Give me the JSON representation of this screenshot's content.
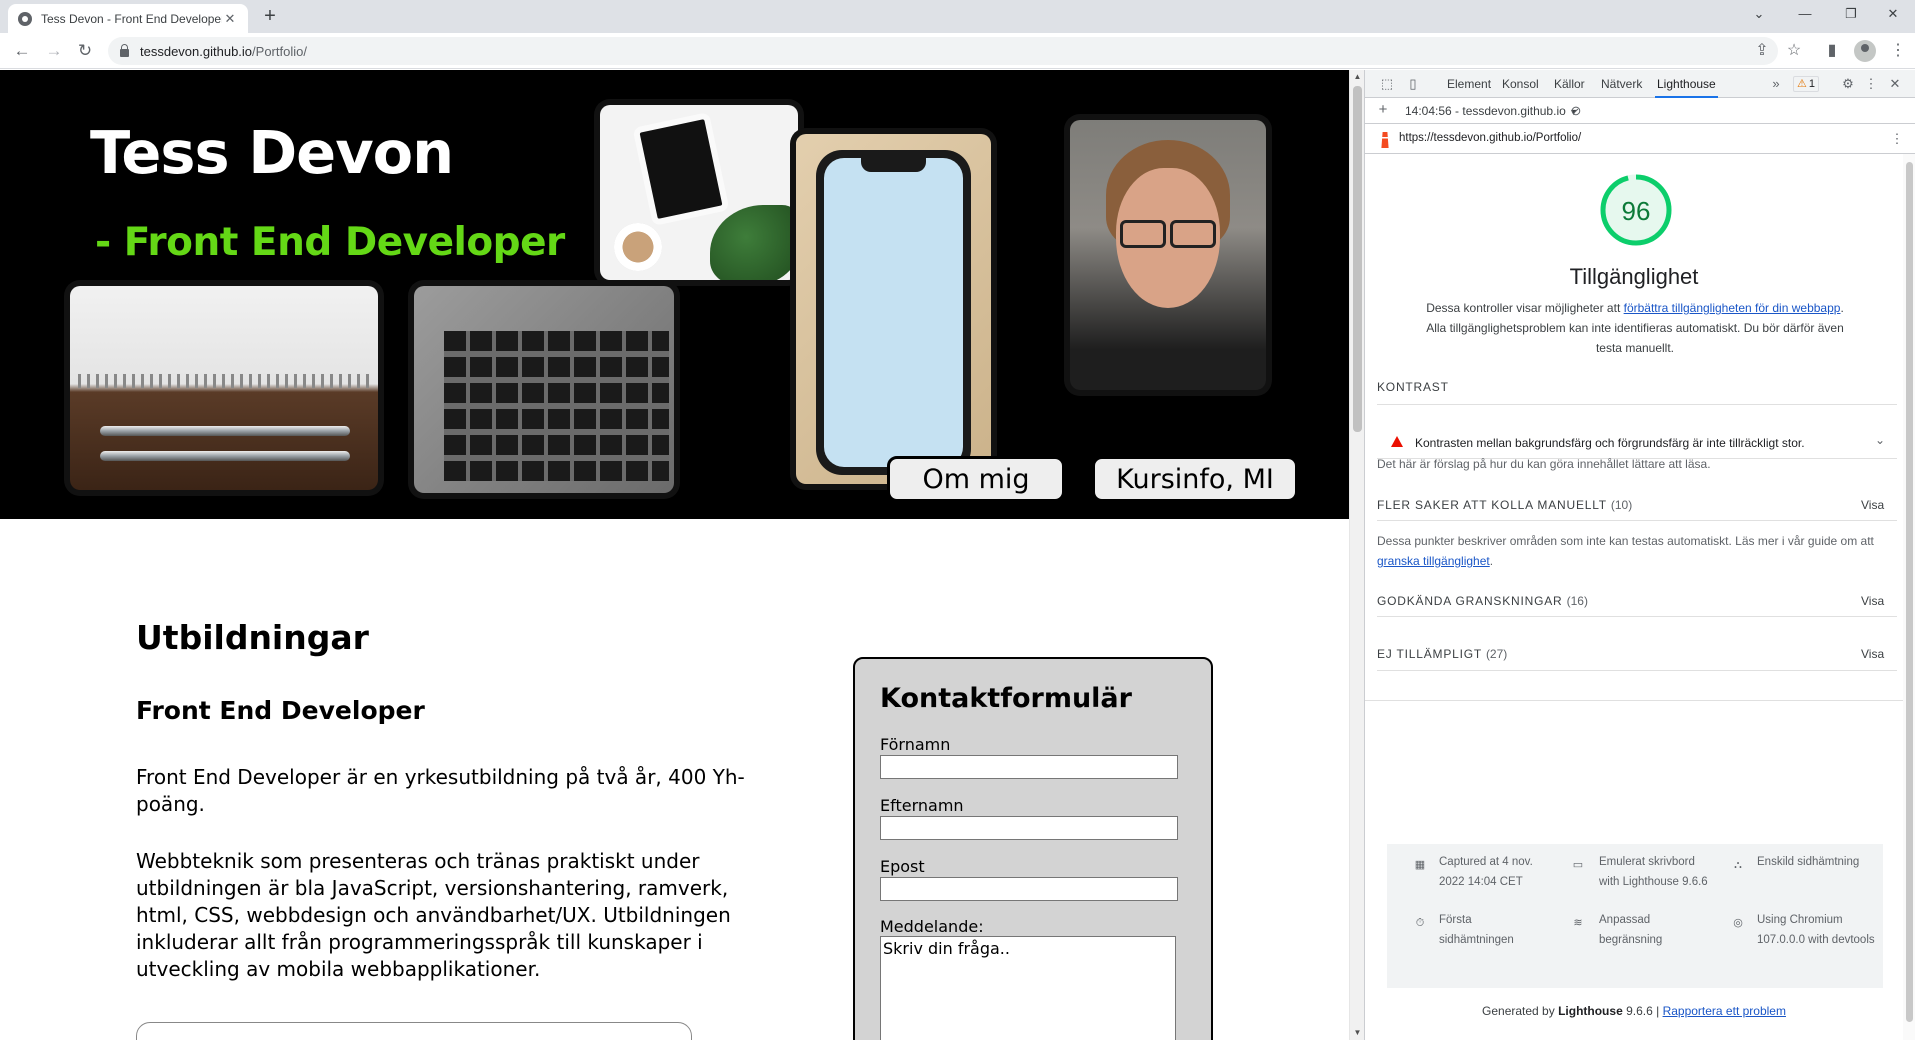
{
  "browser": {
    "tab_title": "Tess Devon - Front End Developer",
    "new_tab": "+",
    "url_host": "tessdevon.github.io",
    "url_path": "/Portfolio/",
    "icons": [
      "back-icon",
      "forward-icon",
      "reload-icon",
      "share-icon",
      "star-icon",
      "side-panel-icon",
      "profile-icon",
      "menu-icon"
    ]
  },
  "hero": {
    "name": "Tess Devon",
    "role": "- Front End Developer",
    "buttons": [
      "Om mig",
      "Kursinfo, MI"
    ]
  },
  "main": {
    "heading": "Utbildningar",
    "subheading": "Front End Developer",
    "paragraph1": "Front End Developer är en yrkesutbildning på två år, 400 Yh-poäng.",
    "paragraph2": "Webbteknik som presenteras och tränas praktiskt under utbildningen är bla JavaScript, versionshantering, ramverk, html, CSS, webbdesign och användbarhet/UX. Utbildningen inkluderar allt från programmeringsspråk till kunskaper i utveckling av mobila webbapplikationer."
  },
  "form": {
    "title": "Kontaktformulär",
    "firstname_label": "Förnamn",
    "lastname_label": "Efternamn",
    "email_label": "Epost",
    "message_label": "Meddelande:",
    "message_placeholder": "Skriv din fråga.."
  },
  "devtools": {
    "tabs": [
      "Element",
      "Konsol",
      "Källor",
      "Nätverk",
      "Lighthouse"
    ],
    "more": "»",
    "warning_count": "1",
    "report_select": "14:04:56 - tessdevon.github.io",
    "report_url": "https://tessdevon.github.io/Portfolio/",
    "score": "96",
    "score_fraction": 0.96,
    "score_color": "#0cce6b",
    "category": "Tillgänglighet",
    "desc_before": "Dessa kontroller visar möjligheter att ",
    "desc_link": "förbättra tillgängligheten för din webbapp",
    "desc_after": ". Alla tillgänglighetsproblem kan inte identifieras automatiskt. Du bör därför även testa manuellt.",
    "contrast_heading": "KONTRAST",
    "contrast_audit": "Kontrasten mellan bakgrundsfärg och förgrundsfärg är inte tillräckligt stor.",
    "contrast_note": "Det här är förslag på hur du kan göra innehållet lättare att läsa.",
    "manual_heading": "FLER SAKER ATT KOLLA MANUELLT",
    "manual_count": "(10)",
    "manual_note_before": "Dessa punkter beskriver områden som inte kan testas automatiskt. Läs mer i vår guide om att ",
    "manual_note_link": "granska tillgänglighet",
    "manual_note_after": ".",
    "passed_heading": "GODKÄNDA GRANSKNINGAR",
    "passed_count": "(16)",
    "na_heading": "EJ TILLÄMPLIGT",
    "na_count": "(27)",
    "show": "Visa",
    "footer": {
      "captured": "Captured at 4 nov. 2022 14:04 CET",
      "emulated": "Emulerat skrivbord with Lighthouse 9.6.6",
      "single": "Enskild sidhämtning",
      "first_load": "Första sidhämtningen",
      "throttling": "Anpassad begränsning",
      "chromium": "Using Chromium 107.0.0.0 with devtools"
    },
    "generated_prefix": "Generated by ",
    "generated_name": "Lighthouse",
    "generated_version": " 9.6.6 | ",
    "report_issue": "Rapportera ett problem"
  }
}
